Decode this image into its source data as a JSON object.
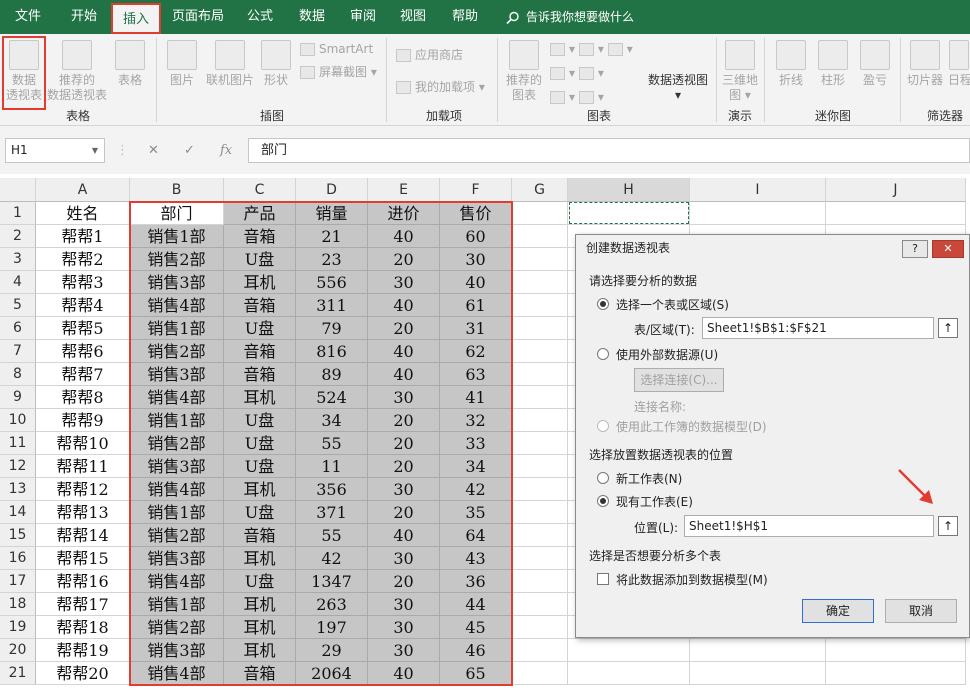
{
  "menu": {
    "tabs": [
      {
        "label": "文件"
      },
      {
        "label": "开始"
      },
      {
        "label": "插入"
      },
      {
        "label": "页面布局"
      },
      {
        "label": "公式"
      },
      {
        "label": "数据"
      },
      {
        "label": "审阅"
      },
      {
        "label": "视图"
      },
      {
        "label": "帮助"
      }
    ],
    "active_tab": "插入",
    "tell_me": "告诉我你想要做什么"
  },
  "ribbon": {
    "groups": {
      "tables": "表格",
      "illustrations": "插图",
      "addins": "加载项",
      "charts": "图表",
      "tours": "演示",
      "sparklines": "迷你图",
      "filters": "筛选器"
    },
    "buttons": {
      "pivot_table_line1": "数据",
      "pivot_table_line2": "透视表",
      "rec_pivot_line1": "推荐的",
      "rec_pivot_line2": "数据透视表",
      "table": "表格",
      "pictures": "图片",
      "online_pictures": "联机图片",
      "shapes": "形状",
      "smartart": "SmartArt",
      "screenshot": "屏幕截图",
      "store": "应用商店",
      "my_addins": "我的加载项",
      "rec_charts_line1": "推荐的",
      "rec_charts_line2": "图表",
      "pivot_chart": "数据透视图",
      "map3d_line1": "三维地",
      "map3d_line2": "图",
      "spark_line": "折线",
      "spark_column": "柱形",
      "spark_winloss": "盈亏",
      "slicer": "切片器",
      "timeline": "日程"
    },
    "colors": {
      "accent": "#217346",
      "highlight": "#e03c31"
    }
  },
  "formula_bar": {
    "name_box": "H1",
    "fx": "fx",
    "content": "部门"
  },
  "sheet": {
    "columns": [
      "A",
      "B",
      "C",
      "D",
      "E",
      "F",
      "G",
      "H",
      "I",
      "J"
    ],
    "rows": [
      [
        "姓名",
        "部门",
        "产品",
        "销量",
        "进价",
        "售价"
      ],
      [
        "帮帮1",
        "销售1部",
        "音箱",
        "21",
        "40",
        "60"
      ],
      [
        "帮帮2",
        "销售2部",
        "U盘",
        "23",
        "20",
        "30"
      ],
      [
        "帮帮3",
        "销售3部",
        "耳机",
        "556",
        "30",
        "40"
      ],
      [
        "帮帮4",
        "销售4部",
        "音箱",
        "311",
        "40",
        "61"
      ],
      [
        "帮帮5",
        "销售1部",
        "U盘",
        "79",
        "20",
        "31"
      ],
      [
        "帮帮6",
        "销售2部",
        "音箱",
        "816",
        "40",
        "62"
      ],
      [
        "帮帮7",
        "销售3部",
        "音箱",
        "89",
        "40",
        "63"
      ],
      [
        "帮帮8",
        "销售4部",
        "耳机",
        "524",
        "30",
        "41"
      ],
      [
        "帮帮9",
        "销售1部",
        "U盘",
        "34",
        "20",
        "32"
      ],
      [
        "帮帮10",
        "销售2部",
        "U盘",
        "55",
        "20",
        "33"
      ],
      [
        "帮帮11",
        "销售3部",
        "U盘",
        "11",
        "20",
        "34"
      ],
      [
        "帮帮12",
        "销售4部",
        "耳机",
        "356",
        "30",
        "42"
      ],
      [
        "帮帮13",
        "销售1部",
        "U盘",
        "371",
        "20",
        "35"
      ],
      [
        "帮帮14",
        "销售2部",
        "音箱",
        "55",
        "40",
        "64"
      ],
      [
        "帮帮15",
        "销售3部",
        "耳机",
        "42",
        "30",
        "43"
      ],
      [
        "帮帮16",
        "销售4部",
        "U盘",
        "1347",
        "20",
        "36"
      ],
      [
        "帮帮17",
        "销售1部",
        "耳机",
        "263",
        "30",
        "44"
      ],
      [
        "帮帮18",
        "销售2部",
        "耳机",
        "197",
        "30",
        "45"
      ],
      [
        "帮帮19",
        "销售3部",
        "耳机",
        "29",
        "30",
        "46"
      ],
      [
        "帮帮20",
        "销售4部",
        "音箱",
        "2064",
        "40",
        "65"
      ]
    ]
  },
  "dialog": {
    "title": "创建数据透视表",
    "help": "?",
    "close": "✕",
    "section1": "请选择要分析的数据",
    "opt_range": "选择一个表或区域(S)",
    "range_label": "表/区域(T):",
    "range_value": "Sheet1!$B$1:$F$21",
    "opt_external": "使用外部数据源(U)",
    "choose_conn": "选择连接(C)...",
    "conn_name": "连接名称:",
    "opt_model": "使用此工作簿的数据模型(D)",
    "section2": "选择放置数据透视表的位置",
    "opt_new": "新工作表(N)",
    "opt_existing": "现有工作表(E)",
    "loc_label": "位置(L):",
    "loc_value": "Sheet1!$H$1",
    "section3": "选择是否想要分析多个表",
    "add_model": "将此数据添加到数据模型(M)",
    "ok": "确定",
    "cancel": "取消",
    "arrow": "↑"
  }
}
